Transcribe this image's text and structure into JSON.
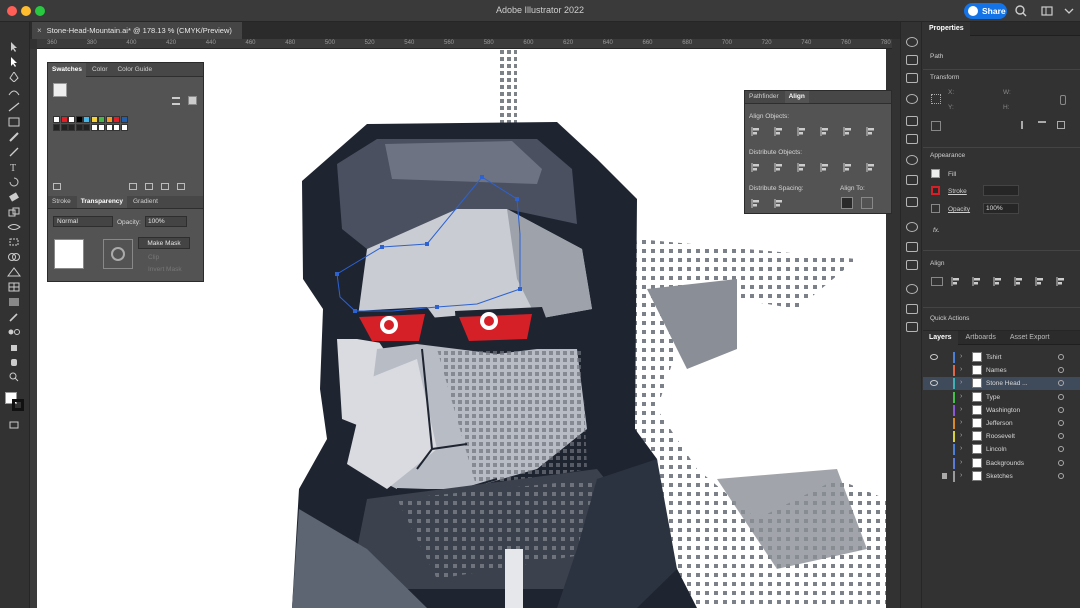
{
  "app": {
    "title": "Adobe Illustrator 2022",
    "share_label": "Share"
  },
  "document": {
    "tab_title": "Stone-Head-Mountain.ai* @ 178.13 % (CMYK/Preview)",
    "close_glyph": "×"
  },
  "ruler": {
    "ticks": [
      "360",
      "380",
      "400",
      "420",
      "440",
      "460",
      "480",
      "500",
      "520",
      "540",
      "560",
      "580",
      "600",
      "620",
      "640",
      "660",
      "680",
      "700",
      "720",
      "740",
      "760",
      "780"
    ]
  },
  "swatches_panel": {
    "tabs": [
      "Swatches",
      "Color",
      "Color Guide"
    ],
    "sub_tabs": [
      "Stroke",
      "Transparency",
      "Gradient"
    ],
    "blend_mode": "Normal",
    "opacity_label": "Opacity:",
    "opacity_value": "100%",
    "make_mask_label": "Make Mask",
    "clip_label": "Clip",
    "invert_mask_label": "Invert Mask",
    "swatch_colors": [
      "#ffffff",
      "#e21f26",
      "#ffffff",
      "#000000",
      "#44b7e8",
      "#f6d23a",
      "#47b649",
      "#f39b22",
      "#e21f26",
      "#1f5fae"
    ]
  },
  "align_panel": {
    "tabs": [
      "Pathfinder",
      "Align"
    ],
    "align_objects_label": "Align Objects:",
    "distribute_objects_label": "Distribute Objects:",
    "distribute_spacing_label": "Distribute Spacing:",
    "align_to_label": "Align To:"
  },
  "properties": {
    "tab": "Properties",
    "path_label": "Path",
    "transform_label": "Transform",
    "x_label": "X:",
    "w_label": "W:",
    "y_label": "Y:",
    "h_label": "H:",
    "appearance_label": "Appearance",
    "fill_label": "Fill",
    "stroke_label": "Stroke",
    "opacity_label": "Opacity",
    "opacity_value": "100%",
    "fx_label": "fx.",
    "align_label": "Align",
    "quick_actions_label": "Quick Actions"
  },
  "layers_panel": {
    "tabs": [
      "Layers",
      "Artboards",
      "Asset Export"
    ],
    "rows": [
      {
        "name": "Tshirt",
        "color": "#4d7fd6",
        "visible": true,
        "locked": false,
        "selected": false
      },
      {
        "name": "Names",
        "color": "#e0664a",
        "visible": false,
        "locked": false,
        "selected": false
      },
      {
        "name": "Stone Head ...",
        "color": "#3fb0b4",
        "visible": true,
        "locked": false,
        "selected": true
      },
      {
        "name": "Type",
        "color": "#45c04a",
        "visible": false,
        "locked": false,
        "selected": false
      },
      {
        "name": "Washington",
        "color": "#8a5ad6",
        "visible": false,
        "locked": false,
        "selected": false
      },
      {
        "name": "Jefferson",
        "color": "#d68a2a",
        "visible": false,
        "locked": false,
        "selected": false
      },
      {
        "name": "Roosevelt",
        "color": "#d6d23a",
        "visible": false,
        "locked": false,
        "selected": false
      },
      {
        "name": "Lincoln",
        "color": "#4d7fd6",
        "visible": false,
        "locked": false,
        "selected": false
      },
      {
        "name": "Backgrounds",
        "color": "#5a7ad6",
        "visible": false,
        "locked": false,
        "selected": false
      },
      {
        "name": "Sketches",
        "color": "#9a9a9a",
        "visible": false,
        "locked": true,
        "selected": false
      }
    ]
  },
  "colors": {
    "accent": "#1473e6",
    "eye_red": "#d62028",
    "dark_navy": "#1e2430",
    "slate": "#5d6472"
  }
}
